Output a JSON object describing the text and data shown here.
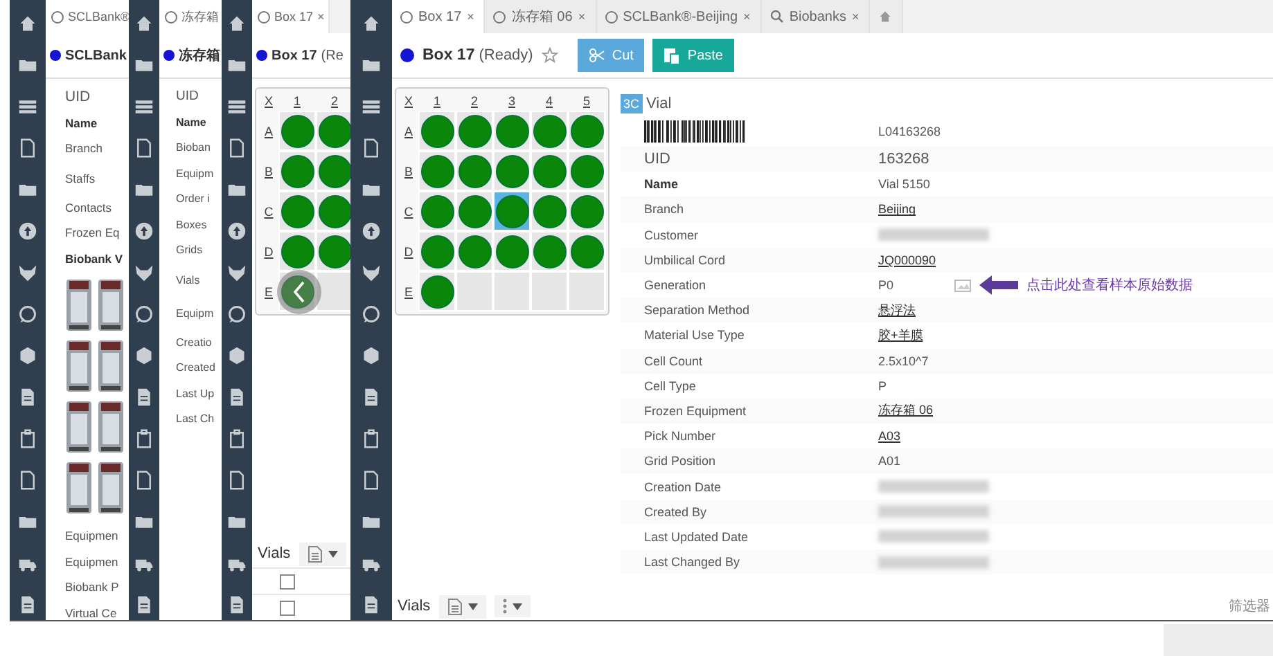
{
  "windows": [
    {
      "kind": "record",
      "tabs": [
        {
          "label": "SCLBank®",
          "selected": true,
          "kind": "record"
        }
      ],
      "header": {
        "title": "SCLBank"
      },
      "fields": [
        {
          "label": "UID",
          "kind": "large"
        },
        {
          "label": "Name",
          "kind": "bold"
        },
        {
          "label": "Branch",
          "kind": "plain"
        },
        {
          "label": "Staffs",
          "kind": "tall"
        },
        {
          "label": "Contacts",
          "kind": "plain"
        },
        {
          "label": "Frozen Eq",
          "kind": "plain"
        },
        {
          "label": "Biobank V",
          "kind": "bold"
        },
        {
          "kind": "pictures"
        },
        {
          "label": "Equipmen",
          "kind": "plain"
        },
        {
          "label": "Equipmen",
          "kind": "plain"
        },
        {
          "label": "Biobank P",
          "kind": "plain"
        },
        {
          "label": "Virtual Ce",
          "kind": "plain"
        }
      ]
    },
    {
      "kind": "record",
      "tabs": [
        {
          "label": "冻存箱",
          "selected": true,
          "kind": "record"
        }
      ],
      "header": {
        "title": "冻存箱"
      },
      "fields": [
        {
          "label": "UID",
          "kind": "large"
        },
        {
          "label": "Name",
          "kind": "bold"
        },
        {
          "label": "Bioban",
          "kind": "plain"
        },
        {
          "label": "Equipm",
          "kind": "plain"
        },
        {
          "label": "Order i",
          "kind": "plain"
        },
        {
          "label": "Boxes",
          "kind": "plain"
        },
        {
          "label": "Grids",
          "kind": "plain"
        },
        {
          "label": "Vials",
          "kind": "tall"
        },
        {
          "label": "Equipm",
          "kind": "tall"
        },
        {
          "label": "Creatio",
          "kind": "plain"
        },
        {
          "label": "Created",
          "kind": "plain"
        },
        {
          "label": "Last Up",
          "kind": "plain"
        },
        {
          "label": "Last Ch",
          "kind": "plain"
        }
      ]
    },
    {
      "kind": "box",
      "tabs": [
        {
          "label": "Box 17",
          "selected": true,
          "kind": "record",
          "close": "×"
        }
      ],
      "header": {
        "title": "Box 17",
        "status": "(Re"
      },
      "grid": {
        "corner": "X",
        "columns": [
          "1",
          "2"
        ],
        "rows": [
          {
            "label": "A",
            "wells": [
              {
                "filled": true,
                "selected": false
              },
              {
                "filled": true,
                "selected": false
              }
            ]
          },
          {
            "label": "B",
            "wells": [
              {
                "filled": true,
                "selected": false
              },
              {
                "filled": true,
                "selected": false
              }
            ]
          },
          {
            "label": "C",
            "wells": [
              {
                "filled": true,
                "selected": false
              },
              {
                "filled": true,
                "selected": false
              }
            ]
          },
          {
            "label": "D",
            "wells": [
              {
                "filled": true,
                "selected": false
              },
              {
                "filled": true,
                "selected": false
              }
            ]
          },
          {
            "label": "E",
            "wells": [
              {
                "filled": true,
                "selected": false
              },
              {
                "filled": false,
                "selected": false
              }
            ]
          }
        ]
      },
      "footer": {
        "title": "Vials"
      },
      "list_rows": [
        {
          "checked": false
        },
        {
          "checked": false
        }
      ]
    },
    {
      "kind": "box",
      "tabs": [
        {
          "label": "Box 17",
          "selected": true,
          "kind": "record",
          "close": "×"
        },
        {
          "label": "冻存箱 06",
          "selected": false,
          "kind": "record",
          "close": "×"
        },
        {
          "label": "SCLBank®-Beijing",
          "selected": false,
          "kind": "record",
          "close": "×"
        },
        {
          "label": "Biobanks",
          "selected": false,
          "kind": "search",
          "close": "×"
        },
        {
          "selected": false,
          "kind": "home"
        }
      ],
      "header": {
        "title": "Box 17",
        "status": "(Ready)",
        "starred": false,
        "buttons": [
          {
            "label": "Cut",
            "kind": "cut"
          },
          {
            "label": "Paste",
            "kind": "paste"
          }
        ]
      },
      "grid": {
        "corner": "X",
        "columns": [
          "1",
          "2",
          "3",
          "4",
          "5"
        ],
        "rows": [
          {
            "label": "A",
            "wells": [
              {
                "filled": true,
                "selected": false
              },
              {
                "filled": true,
                "selected": false
              },
              {
                "filled": true,
                "selected": false
              },
              {
                "filled": true,
                "selected": false
              },
              {
                "filled": true,
                "selected": false
              }
            ]
          },
          {
            "label": "B",
            "wells": [
              {
                "filled": true,
                "selected": false
              },
              {
                "filled": true,
                "selected": false
              },
              {
                "filled": true,
                "selected": false
              },
              {
                "filled": true,
                "selected": false
              },
              {
                "filled": true,
                "selected": false
              }
            ]
          },
          {
            "label": "C",
            "wells": [
              {
                "filled": true,
                "selected": false
              },
              {
                "filled": true,
                "selected": false
              },
              {
                "filled": true,
                "selected": true
              },
              {
                "filled": true,
                "selected": false
              },
              {
                "filled": true,
                "selected": false
              }
            ]
          },
          {
            "label": "D",
            "wells": [
              {
                "filled": true,
                "selected": false
              },
              {
                "filled": true,
                "selected": false
              },
              {
                "filled": true,
                "selected": false
              },
              {
                "filled": true,
                "selected": false
              },
              {
                "filled": true,
                "selected": false
              }
            ]
          },
          {
            "label": "E",
            "wells": [
              {
                "filled": true,
                "selected": false
              },
              {
                "filled": false,
                "selected": false
              },
              {
                "filled": false,
                "selected": false
              },
              {
                "filled": false,
                "selected": false
              },
              {
                "filled": false,
                "selected": false
              }
            ]
          }
        ]
      },
      "details": {
        "badge": "3C",
        "title": "Vial",
        "barcode": "L04163268",
        "rows": [
          {
            "label": "UID",
            "value": "163268",
            "kind": "id"
          },
          {
            "label": "Name",
            "value": "Vial 5150",
            "kind": "name"
          },
          {
            "label": "Branch",
            "value": "Beijing",
            "kind": "link"
          },
          {
            "label": "Customer",
            "kind": "redacted"
          },
          {
            "label": "Umbilical Cord",
            "value": "JQ000090",
            "kind": "link"
          },
          {
            "label": "Generation",
            "value": "P0",
            "kind": "text",
            "note": "点击此处查看样本原始数据"
          },
          {
            "label": "Separation Method",
            "value": "悬浮法",
            "kind": "link"
          },
          {
            "label": "Material Use Type",
            "value": "胶+羊膜",
            "kind": "link"
          },
          {
            "label": "Cell Count",
            "value": "2.5x10^7",
            "kind": "text"
          },
          {
            "label": "Cell Type",
            "value": "P",
            "kind": "text"
          },
          {
            "label": "Frozen Equipment",
            "value": "冻存箱 06",
            "kind": "link"
          },
          {
            "label": "Pick Number",
            "value": "A03",
            "kind": "link"
          },
          {
            "label": "Grid Position",
            "value": "A01",
            "kind": "text"
          },
          {
            "label": "Creation Date",
            "kind": "redacted"
          },
          {
            "label": "Created By",
            "kind": "redacted"
          },
          {
            "label": "Last Updated Date",
            "kind": "redacted"
          },
          {
            "label": "Last Changed By",
            "kind": "redacted"
          }
        ]
      },
      "footer": {
        "title": "Vials",
        "filter": "筛选器"
      }
    }
  ]
}
